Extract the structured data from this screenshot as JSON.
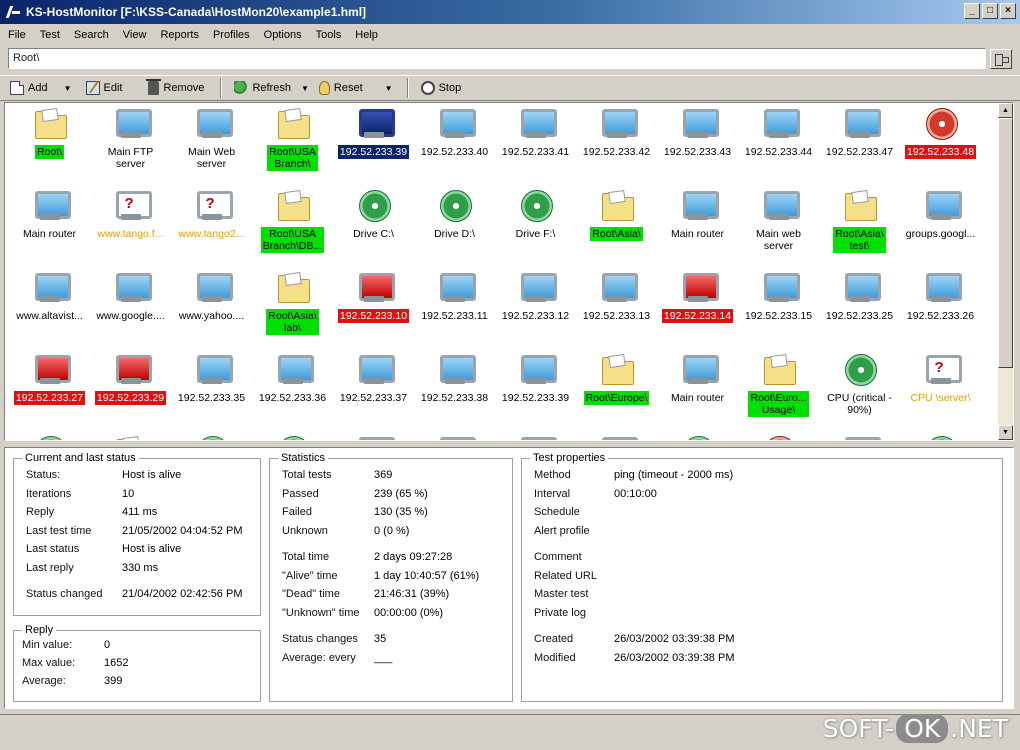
{
  "window": {
    "title": "KS-HostMonitor  [F:\\KSS-Canada\\HostMon20\\example1.hml]",
    "controls": [
      "_",
      "□",
      "×"
    ]
  },
  "menu": [
    "File",
    "Test",
    "Search",
    "View",
    "Reports",
    "Profiles",
    "Options",
    "Tools",
    "Help"
  ],
  "address": {
    "value": "Root\\"
  },
  "toolbar": {
    "add": "Add",
    "edit": "Edit",
    "remove": "Remove",
    "refresh": "Refresh",
    "reset": "Reset",
    "stop": "Stop"
  },
  "tiles": [
    {
      "label": "Root\\",
      "icon": "folder-icon",
      "status": "ok"
    },
    {
      "label": "Main FTP\nserver",
      "icon": "monitor-icon",
      "status": ""
    },
    {
      "label": "Main Web\nserver",
      "icon": "monitor-icon",
      "status": ""
    },
    {
      "label": "Root\\USA\nBranch\\",
      "icon": "folder-icon",
      "status": "ok"
    },
    {
      "label": "192.52.233.39",
      "icon": "monitor-icon-dark",
      "status": "sel"
    },
    {
      "label": "192.52.233.40",
      "icon": "monitor-icon",
      "status": ""
    },
    {
      "label": "192.52.233.41",
      "icon": "monitor-icon",
      "status": ""
    },
    {
      "label": "192.52.233.42",
      "icon": "monitor-icon",
      "status": ""
    },
    {
      "label": "192.52.233.43",
      "icon": "monitor-icon",
      "status": ""
    },
    {
      "label": "192.52.233.44",
      "icon": "monitor-icon",
      "status": ""
    },
    {
      "label": "192.52.233.47",
      "icon": "monitor-icon",
      "status": ""
    },
    {
      "label": "192.52.233.48",
      "icon": "disk-icon-red",
      "status": "bad"
    },
    {
      "label": "Main router",
      "icon": "monitor-icon",
      "status": ""
    },
    {
      "label": "www.tango.f...",
      "icon": "monitor-icon-question",
      "status": "unk"
    },
    {
      "label": "www.tango2...",
      "icon": "monitor-icon-question",
      "status": "unk"
    },
    {
      "label": "Root\\USA\nBranch\\DB...",
      "icon": "folder-icon",
      "status": "ok"
    },
    {
      "label": "Drive C:\\",
      "icon": "disk-icon",
      "status": ""
    },
    {
      "label": "Drive D:\\",
      "icon": "disk-icon",
      "status": ""
    },
    {
      "label": "Drive F:\\",
      "icon": "disk-icon",
      "status": ""
    },
    {
      "label": "Root\\Asia\\",
      "icon": "folder-icon",
      "status": "ok"
    },
    {
      "label": "Main router",
      "icon": "monitor-icon",
      "status": ""
    },
    {
      "label": "Main web\nserver",
      "icon": "monitor-icon",
      "status": ""
    },
    {
      "label": "Root\\Asia\\\ntest\\",
      "icon": "folder-icon",
      "status": "ok"
    },
    {
      "label": "groups.googl...",
      "icon": "monitor-icon",
      "status": ""
    },
    {
      "label": "www.altavist...",
      "icon": "monitor-icon",
      "status": ""
    },
    {
      "label": "www.google....",
      "icon": "monitor-icon",
      "status": ""
    },
    {
      "label": "www.yahoo....",
      "icon": "monitor-icon",
      "status": ""
    },
    {
      "label": "Root\\Asia\\\nlab\\",
      "icon": "folder-icon",
      "status": "ok"
    },
    {
      "label": "192.52.233.10",
      "icon": "monitor-icon-red",
      "status": "bad"
    },
    {
      "label": "192.52.233.11",
      "icon": "monitor-icon",
      "status": ""
    },
    {
      "label": "192.52.233.12",
      "icon": "monitor-icon",
      "status": ""
    },
    {
      "label": "192.52.233.13",
      "icon": "monitor-icon",
      "status": ""
    },
    {
      "label": "192.52.233.14",
      "icon": "monitor-icon-red",
      "status": "bad"
    },
    {
      "label": "192.52.233.15",
      "icon": "monitor-icon",
      "status": ""
    },
    {
      "label": "192.52.233.25",
      "icon": "monitor-icon",
      "status": ""
    },
    {
      "label": "192.52.233.26",
      "icon": "monitor-icon",
      "status": ""
    },
    {
      "label": "192.52.233.27",
      "icon": "monitor-icon-red",
      "status": "bad"
    },
    {
      "label": "192.52.233.29",
      "icon": "monitor-icon-red",
      "status": "bad"
    },
    {
      "label": "192.52.233.35",
      "icon": "monitor-icon",
      "status": ""
    },
    {
      "label": "192.52.233.36",
      "icon": "monitor-icon",
      "status": ""
    },
    {
      "label": "192.52.233.37",
      "icon": "monitor-icon",
      "status": ""
    },
    {
      "label": "192.52.233.38",
      "icon": "monitor-icon",
      "status": ""
    },
    {
      "label": "192.52.233.39",
      "icon": "monitor-icon",
      "status": ""
    },
    {
      "label": "Root\\Europe\\",
      "icon": "folder-icon",
      "status": "ok"
    },
    {
      "label": "Main router",
      "icon": "monitor-icon",
      "status": ""
    },
    {
      "label": "Root\\Euro...\nUsage\\",
      "icon": "folder-icon",
      "status": "ok"
    },
    {
      "label": "CPU (critical -\n90%)",
      "icon": "disk-icon",
      "status": ""
    },
    {
      "label": "CPU \\server\\",
      "icon": "monitor-icon-question",
      "status": "unk"
    },
    {
      "label": "",
      "icon": "disk-icon",
      "status": ""
    },
    {
      "label": "",
      "icon": "folder-icon",
      "status": ""
    },
    {
      "label": "",
      "icon": "disk-icon",
      "status": ""
    },
    {
      "label": "",
      "icon": "disk-icon",
      "status": ""
    },
    {
      "label": "",
      "icon": "monitor-icon",
      "status": ""
    },
    {
      "label": "",
      "icon": "monitor-icon-red",
      "status": ""
    },
    {
      "label": "",
      "icon": "monitor-icon-red",
      "status": ""
    },
    {
      "label": "",
      "icon": "monitor-icon-red",
      "status": ""
    },
    {
      "label": "",
      "icon": "disk-icon",
      "status": ""
    },
    {
      "label": "",
      "icon": "disk-icon-red",
      "status": ""
    },
    {
      "label": "",
      "icon": "monitor-icon",
      "status": ""
    },
    {
      "label": "",
      "icon": "disk-icon",
      "status": ""
    }
  ],
  "current_status": {
    "title": "Current and last status",
    "rows": [
      {
        "key": "Status:",
        "value": "Host is alive"
      },
      {
        "key": "Iterations",
        "value": "10"
      },
      {
        "key": "Reply",
        "value": "411 ms"
      },
      {
        "key": "Last test time",
        "value": "21/05/2002 04:04:52 PM"
      },
      {
        "key": "Last status",
        "value": "Host is alive"
      },
      {
        "key": "Last reply",
        "value": "330 ms"
      },
      {
        "key": "Status changed",
        "value": "21/04/2002 02:42:56 PM"
      }
    ]
  },
  "reply": {
    "title": "Reply",
    "rows": [
      {
        "key": "Min value:",
        "value": "0"
      },
      {
        "key": "Max value:",
        "value": "1652"
      },
      {
        "key": "Average:",
        "value": "399"
      }
    ]
  },
  "statistics": {
    "title": "Statistics",
    "rows": [
      {
        "key": "Total tests",
        "value": "369"
      },
      {
        "key": "Passed",
        "value": "239 (65 %)"
      },
      {
        "key": "Failed",
        "value": "130 (35 %)"
      },
      {
        "key": "Unknown",
        "value": "0 (0 %)"
      },
      {
        "key": "Total time",
        "value": "2 days 09:27:28"
      },
      {
        "key": "\"Alive\" time",
        "value": "1 day 10:40:57 (61%)"
      },
      {
        "key": "\"Dead\" time",
        "value": "21:46:31 (39%)"
      },
      {
        "key": "\"Unknown\" time",
        "value": "00:00:00 (0%)"
      },
      {
        "key": "Status changes",
        "value": "35"
      },
      {
        "key": "Average: every",
        "value": "___"
      }
    ]
  },
  "test_properties": {
    "title": "Test properties",
    "rows": [
      {
        "key": "Method",
        "value": "ping (timeout - 2000 ms)"
      },
      {
        "key": "Interval",
        "value": "00:10:00"
      },
      {
        "key": "Schedule",
        "value": ""
      },
      {
        "key": "Alert profile",
        "value": ""
      },
      {
        "key": "Comment",
        "value": ""
      },
      {
        "key": "Related URL",
        "value": ""
      },
      {
        "key": "Master test",
        "value": ""
      },
      {
        "key": "Private log",
        "value": ""
      },
      {
        "key": "Created",
        "value": "26/03/2002 03:39:38 PM"
      },
      {
        "key": "Modified",
        "value": "26/03/2002 03:39:38 PM"
      }
    ]
  },
  "watermark": {
    "left": "SOFT-",
    "mid": "OK",
    "right": ".NET"
  }
}
